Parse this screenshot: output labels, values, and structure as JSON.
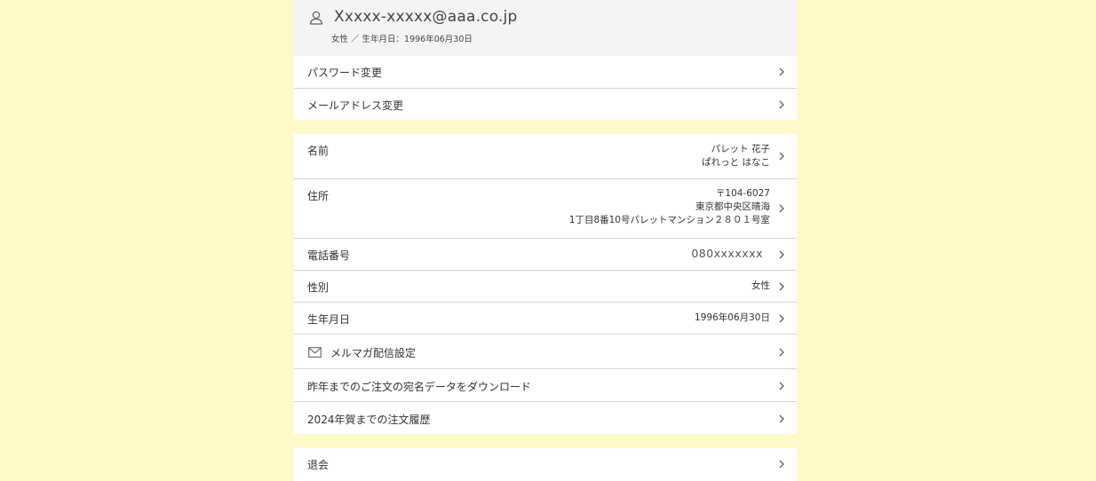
{
  "profile": {
    "email": "Xxxxx-xxxxx@aaa.co.jp",
    "sub": "女性 ／ 生年月日：1996年06月30日"
  },
  "account": {
    "password_label": "パスワード変更",
    "email_change_label": "メールアドレス変更"
  },
  "details": {
    "name_label": "名前",
    "name_kanji": "パレット 花子",
    "name_kana": "ぱれっと はなこ",
    "address_label": "住所",
    "postal": "〒104-6027",
    "address_line1": "東京都中央区晴海",
    "address_line2": "1丁目8番10号パレットマンション２８０１号室",
    "phone_label": "電話番号",
    "phone_value": "080xxxxxxx",
    "gender_label": "性別",
    "gender_value": "女性",
    "birthday_label": "生年月日",
    "birthday_value": "1996年06月30日",
    "newsletter_label": "メルマガ配信設定",
    "download_label": "昨年までのご注文の宛名データをダウンロード",
    "history_label": "2024年賀までの注文履歴"
  },
  "withdraw": {
    "label": "退会"
  },
  "icons": {
    "user": "user-icon",
    "mail": "mail-icon",
    "chevron": "chevron-right-icon"
  },
  "colors": {
    "page_background": "#fff9c9",
    "header_background": "#f4f4f4",
    "card_background": "#ffffff",
    "divider": "#d6d6d6"
  }
}
